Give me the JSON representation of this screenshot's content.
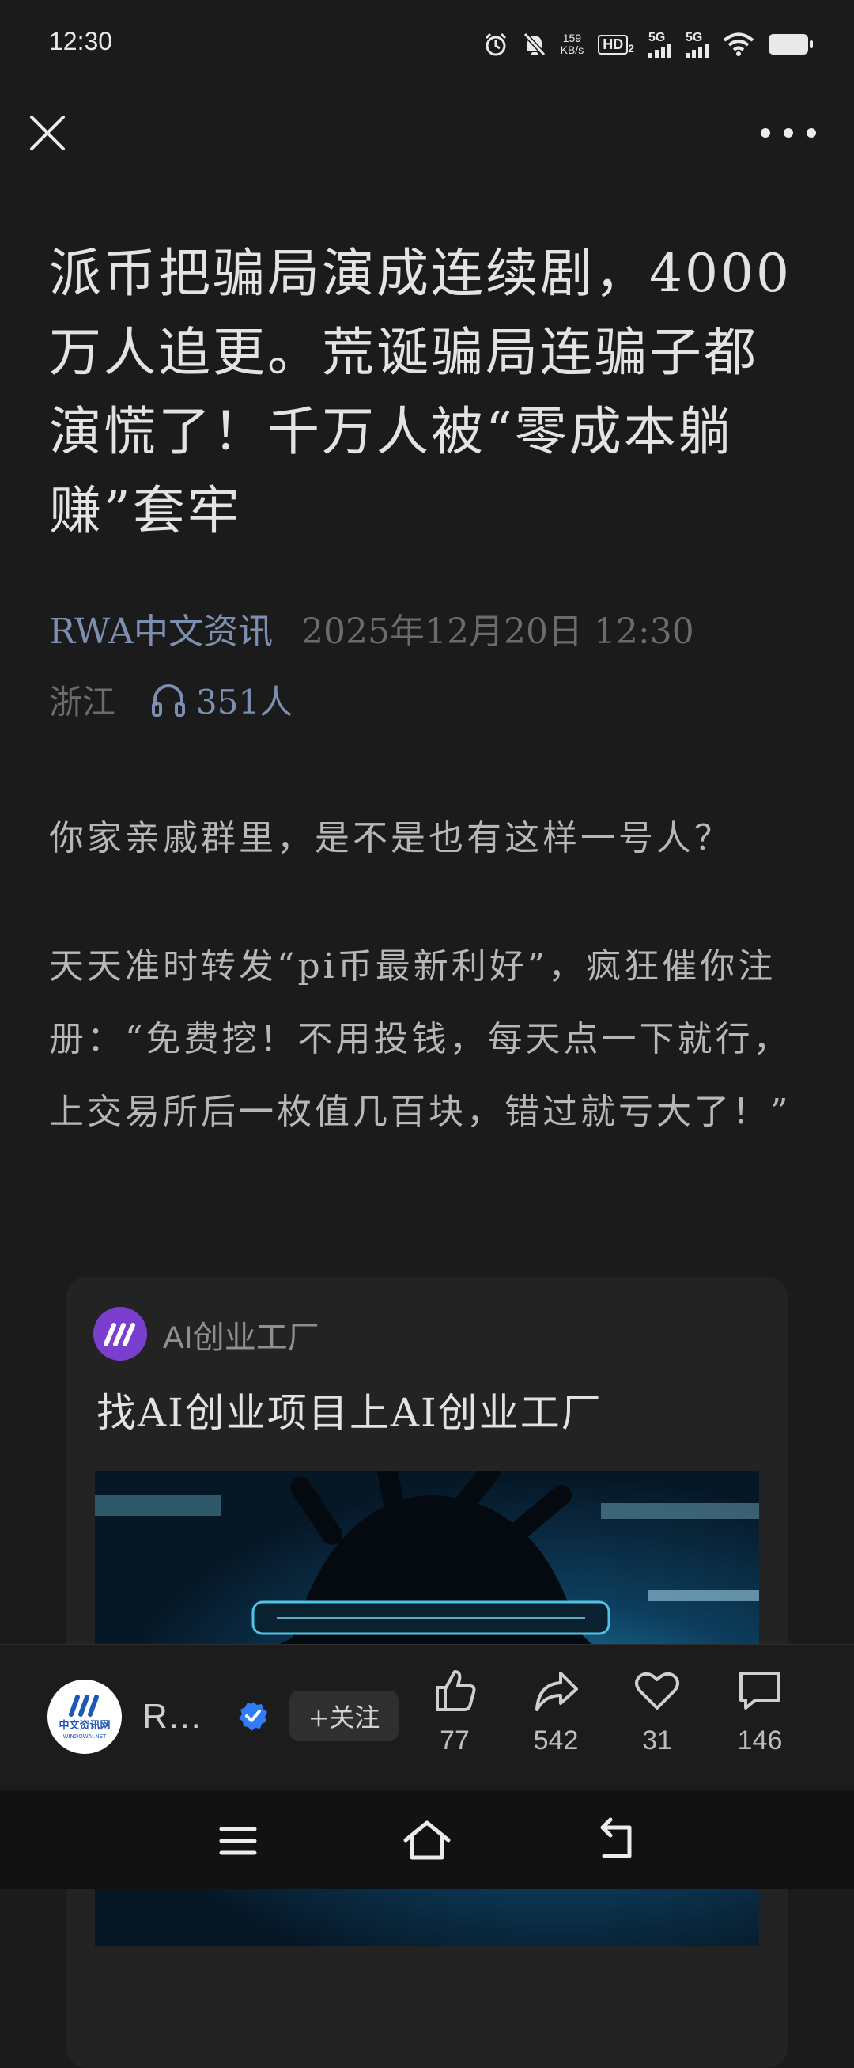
{
  "status_bar": {
    "time": "12:30",
    "net_speed_value": "159",
    "net_speed_unit": "KB/s",
    "hd_label": "HD",
    "hd_sub": "2",
    "sim1_label": "5G",
    "sim2_label": "5G",
    "icons": [
      "alarm-icon",
      "mute-bell-icon",
      "wifi-icon",
      "battery-icon"
    ]
  },
  "toolbar": {
    "close_icon": "close-icon",
    "more_icon": "more-dots-icon"
  },
  "article": {
    "title": "派币把骗局演成连续剧，4000万人追更。荒诞骗局连骗子都演慌了！千万人被“零成本躺赚”套牢",
    "author": "RWA中文资讯",
    "date": "2025年12月20日 12:30",
    "region": "浙江",
    "listen_count": "351人",
    "paragraphs": [
      "你家亲戚群里，是不是也有这样一号人？",
      "天天准时转发“pi币最新利好”，疯狂催你注册：“免费挖！不用投钱，每天点一下就行，上交易所后一枚值几百块，错过就亏大了！”"
    ]
  },
  "ad_card": {
    "source": "AI创业工厂",
    "title": "找AI创业项目上AI创业工厂"
  },
  "action_bar": {
    "publisher_name": "R…",
    "publisher_logo_text": "中文资讯网",
    "publisher_logo_sub": "WINDOWAI.NET",
    "follow_label": "+关注",
    "like_count": "77",
    "share_count": "542",
    "favorite_count": "31",
    "comment_count": "146"
  },
  "colors": {
    "background": "#1b1b1c",
    "author_link": "#7d8fb0",
    "verified_badge": "#2f7cf6",
    "ad_logo": "#7b3fd0"
  }
}
